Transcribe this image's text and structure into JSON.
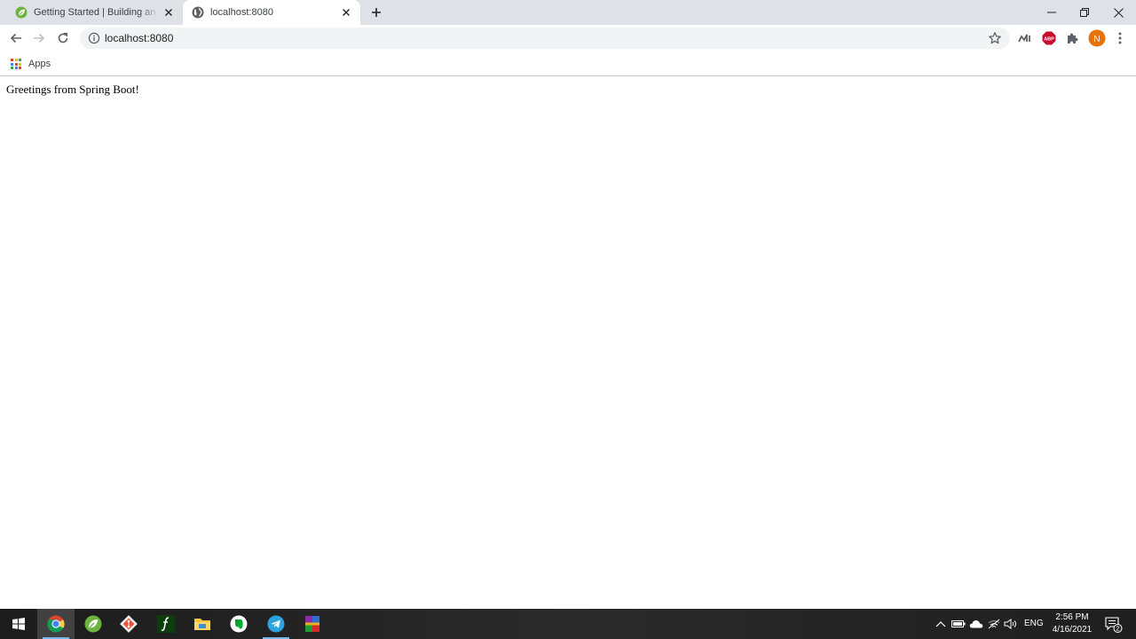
{
  "browser": {
    "tabs": [
      {
        "title": "Getting Started | Building an Application with Spring Boot",
        "active": false,
        "favicon": "spring-leaf-icon"
      },
      {
        "title": "localhost:8080",
        "active": true,
        "favicon": "globe-icon"
      }
    ],
    "address": {
      "url": "localhost:8080",
      "icon": "info-icon"
    },
    "bookmarks": [
      {
        "label": "Apps",
        "icon": "apps-grid-icon"
      }
    ],
    "profile_initial": "N",
    "extensions": [
      "metrics-extension-icon",
      "adblock-plus-icon",
      "puzzle-extensions-icon"
    ],
    "colors": {
      "tabstrip": "#dee1e6",
      "omnibox": "#f1f3f4",
      "profile": "#e8710a",
      "abp": "#c70d2c"
    }
  },
  "page": {
    "greeting": "Greetings from Spring Boot!"
  },
  "taskbar": {
    "apps": [
      {
        "name": "start-button-icon"
      },
      {
        "name": "chrome-icon",
        "active": true
      },
      {
        "name": "spring-tool-suite-icon"
      },
      {
        "name": "git-icon"
      },
      {
        "name": "function-app-icon"
      },
      {
        "name": "file-explorer-icon"
      },
      {
        "name": "evernote-icon"
      },
      {
        "name": "telegram-icon",
        "running": true
      },
      {
        "name": "winrar-icon"
      }
    ],
    "language": "ENG",
    "time": "2:56 PM",
    "date": "4/16/2021",
    "notification_count": "2"
  }
}
